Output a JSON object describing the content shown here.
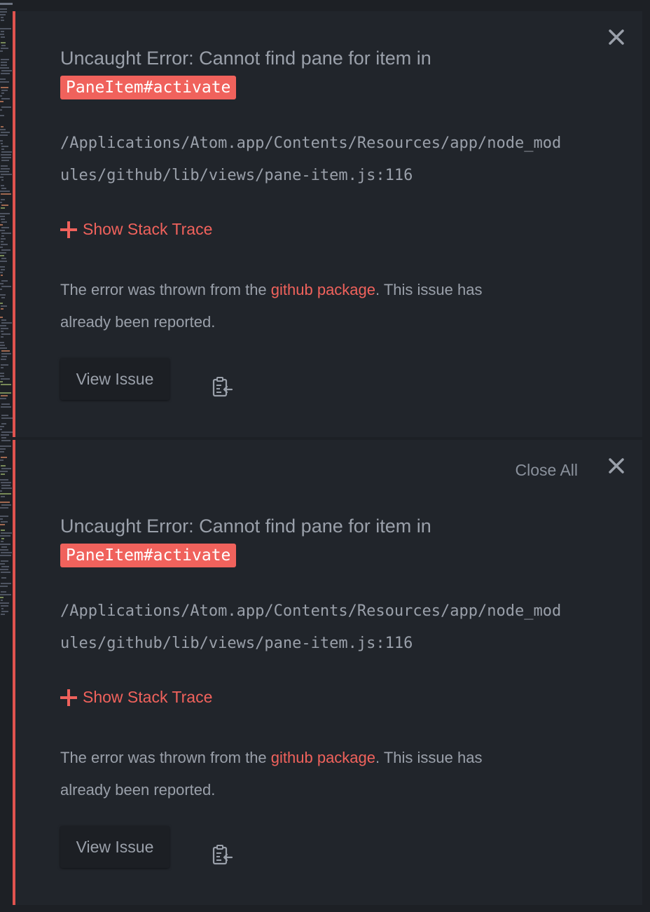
{
  "colors": {
    "accent": "#f0625c",
    "border": "#e0534f",
    "panel": "#21252b",
    "text": "#9aa0aa",
    "background": "#1d2025"
  },
  "notifications": [
    {
      "title": "Uncaught Error: Cannot find pane for item in",
      "code": "PaneItem#activate",
      "path": "/Applications/Atom.app/Contents/Resources/app/node_modules/github/lib/views/pane-item.js:116",
      "stack_toggle_label": "Show Stack Trace",
      "desc_prefix": "The error was thrown from the ",
      "desc_link": "github package",
      "desc_suffix": ". This issue has already been reported.",
      "view_issue_label": "View Issue",
      "icons": {
        "close": "close-icon",
        "plus": "plus-icon",
        "clipboard": "copy-to-clipboard-icon"
      }
    },
    {
      "close_all_label": "Close All",
      "title": "Uncaught Error: Cannot find pane for item in",
      "code": "PaneItem#activate",
      "path": "/Applications/Atom.app/Contents/Resources/app/node_modules/github/lib/views/pane-item.js:116",
      "stack_toggle_label": "Show Stack Trace",
      "desc_prefix": "The error was thrown from the ",
      "desc_link": "github package",
      "desc_suffix": ". This issue has already been reported.",
      "view_issue_label": "View Issue",
      "icons": {
        "close": "close-icon",
        "plus": "plus-icon",
        "clipboard": "copy-to-clipboard-icon"
      }
    }
  ]
}
